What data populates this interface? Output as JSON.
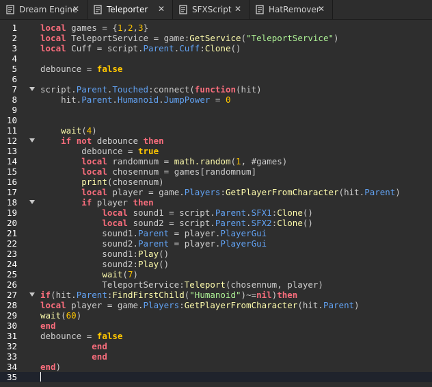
{
  "tabs": [
    {
      "label": "Dream Engine",
      "active": false,
      "icon": "script-icon"
    },
    {
      "label": "Teleporter",
      "active": true,
      "icon": "script-icon"
    },
    {
      "label": "SFXScript",
      "active": false,
      "icon": "script-icon"
    },
    {
      "label": "HatRemover",
      "active": false,
      "icon": "script-icon"
    }
  ],
  "colors": {
    "keyword": "#f86d7c",
    "string": "#adf195",
    "number": "#ffc600",
    "property": "#61a1f1",
    "function": "#fdfbac",
    "text": "#cccccc",
    "background": "#2e2e2e"
  },
  "editor": {
    "current_line": 35,
    "fold_lines": [
      7,
      12,
      18,
      27
    ],
    "lines": [
      [
        [
          "kw",
          "local"
        ],
        [
          "p",
          " games = {"
        ],
        [
          "num",
          "1"
        ],
        [
          "p",
          ","
        ],
        [
          "num",
          "2"
        ],
        [
          "p",
          ","
        ],
        [
          "num",
          "3"
        ],
        [
          "p",
          "}"
        ]
      ],
      [
        [
          "kw",
          "local"
        ],
        [
          "p",
          " TeleportService = game:"
        ],
        [
          "fn",
          "GetService"
        ],
        [
          "p",
          "("
        ],
        [
          "str",
          "\"TeleportService\""
        ],
        [
          "p",
          ")"
        ]
      ],
      [
        [
          "kw",
          "local"
        ],
        [
          "p",
          " Cuff = script."
        ],
        [
          "prop",
          "Parent"
        ],
        [
          "p",
          "."
        ],
        [
          "prop",
          "Cuff"
        ],
        [
          "p",
          ":"
        ],
        [
          "fn",
          "Clone"
        ],
        [
          "p",
          "()"
        ]
      ],
      [],
      [
        [
          "p",
          "debounce = "
        ],
        [
          "bool",
          "false"
        ]
      ],
      [],
      [
        [
          "p",
          "script."
        ],
        [
          "prop",
          "Parent"
        ],
        [
          "p",
          "."
        ],
        [
          "prop",
          "Touched"
        ],
        [
          "p",
          ":connect("
        ],
        [
          "kw",
          "function"
        ],
        [
          "p",
          "(hit)"
        ]
      ],
      [
        [
          "p",
          "    hit."
        ],
        [
          "prop",
          "Parent"
        ],
        [
          "p",
          "."
        ],
        [
          "prop",
          "Humanoid"
        ],
        [
          "p",
          "."
        ],
        [
          "prop",
          "JumpPower"
        ],
        [
          "p",
          " = "
        ],
        [
          "num",
          "0"
        ]
      ],
      [],
      [],
      [
        [
          "p",
          "    "
        ],
        [
          "fn",
          "wait"
        ],
        [
          "p",
          "("
        ],
        [
          "num",
          "4"
        ],
        [
          "p",
          ")"
        ]
      ],
      [
        [
          "p",
          "    "
        ],
        [
          "kw",
          "if"
        ],
        [
          "p",
          " "
        ],
        [
          "kw",
          "not"
        ],
        [
          "p",
          " debounce "
        ],
        [
          "kw",
          "then"
        ]
      ],
      [
        [
          "p",
          "        debounce = "
        ],
        [
          "bool",
          "true"
        ]
      ],
      [
        [
          "p",
          "        "
        ],
        [
          "kw",
          "local"
        ],
        [
          "p",
          " randomnum = "
        ],
        [
          "fn",
          "math.random"
        ],
        [
          "p",
          "("
        ],
        [
          "num",
          "1"
        ],
        [
          "p",
          ", #games)"
        ]
      ],
      [
        [
          "p",
          "        "
        ],
        [
          "kw",
          "local"
        ],
        [
          "p",
          " chosennum = games[randomnum]"
        ]
      ],
      [
        [
          "p",
          "        "
        ],
        [
          "fn",
          "print"
        ],
        [
          "p",
          "(chosennum)"
        ]
      ],
      [
        [
          "p",
          "        "
        ],
        [
          "kw",
          "local"
        ],
        [
          "p",
          " player = game."
        ],
        [
          "prop",
          "Players"
        ],
        [
          "p",
          ":"
        ],
        [
          "fn",
          "GetPlayerFromCharacter"
        ],
        [
          "p",
          "(hit."
        ],
        [
          "prop",
          "Parent"
        ],
        [
          "p",
          ")"
        ]
      ],
      [
        [
          "p",
          "        "
        ],
        [
          "kw",
          "if"
        ],
        [
          "p",
          " player "
        ],
        [
          "kw",
          "then"
        ]
      ],
      [
        [
          "p",
          "            "
        ],
        [
          "kw",
          "local"
        ],
        [
          "p",
          " sound1 = script."
        ],
        [
          "prop",
          "Parent"
        ],
        [
          "p",
          "."
        ],
        [
          "prop",
          "SFX1"
        ],
        [
          "p",
          ":"
        ],
        [
          "fn",
          "Clone"
        ],
        [
          "p",
          "()"
        ]
      ],
      [
        [
          "p",
          "            "
        ],
        [
          "kw",
          "local"
        ],
        [
          "p",
          " sound2 = script."
        ],
        [
          "prop",
          "Parent"
        ],
        [
          "p",
          "."
        ],
        [
          "prop",
          "SFX2"
        ],
        [
          "p",
          ":"
        ],
        [
          "fn",
          "Clone"
        ],
        [
          "p",
          "()"
        ]
      ],
      [
        [
          "p",
          "            sound1."
        ],
        [
          "prop",
          "Parent"
        ],
        [
          "p",
          " = player."
        ],
        [
          "prop",
          "PlayerGui"
        ]
      ],
      [
        [
          "p",
          "            sound2."
        ],
        [
          "prop",
          "Parent"
        ],
        [
          "p",
          " = player."
        ],
        [
          "prop",
          "PlayerGui"
        ]
      ],
      [
        [
          "p",
          "            sound1:"
        ],
        [
          "fn",
          "Play"
        ],
        [
          "p",
          "()"
        ]
      ],
      [
        [
          "p",
          "            sound2:"
        ],
        [
          "fn",
          "Play"
        ],
        [
          "p",
          "()"
        ]
      ],
      [
        [
          "p",
          "            "
        ],
        [
          "fn",
          "wait"
        ],
        [
          "p",
          "("
        ],
        [
          "num",
          "7"
        ],
        [
          "p",
          ")"
        ]
      ],
      [
        [
          "p",
          "            TeleportService:"
        ],
        [
          "fn",
          "Teleport"
        ],
        [
          "p",
          "(chosennum, player)"
        ]
      ],
      [
        [
          "kw",
          "if"
        ],
        [
          "p",
          "(hit."
        ],
        [
          "prop",
          "Parent"
        ],
        [
          "p",
          ":"
        ],
        [
          "fn",
          "FindFirstChild"
        ],
        [
          "p",
          "("
        ],
        [
          "str",
          "\"Humanoid\""
        ],
        [
          "p",
          ")~="
        ],
        [
          "kw",
          "nil"
        ],
        [
          "p",
          ")"
        ],
        [
          "kw",
          "then"
        ]
      ],
      [
        [
          "kw",
          "local"
        ],
        [
          "p",
          " player = game."
        ],
        [
          "prop",
          "Players"
        ],
        [
          "p",
          ":"
        ],
        [
          "fn",
          "GetPlayerFromCharacter"
        ],
        [
          "p",
          "(hit."
        ],
        [
          "prop",
          "Parent"
        ],
        [
          "p",
          ")"
        ]
      ],
      [
        [
          "fn",
          "wait"
        ],
        [
          "p",
          "("
        ],
        [
          "num",
          "60"
        ],
        [
          "p",
          ")"
        ]
      ],
      [
        [
          "kw",
          "end"
        ]
      ],
      [
        [
          "p",
          "debounce = "
        ],
        [
          "bool",
          "false"
        ]
      ],
      [
        [
          "p",
          "          "
        ],
        [
          "kw",
          "end"
        ]
      ],
      [
        [
          "p",
          "          "
        ],
        [
          "kw",
          "end"
        ]
      ],
      [
        [
          "kw",
          "end"
        ],
        [
          "p",
          ")"
        ]
      ],
      []
    ]
  }
}
